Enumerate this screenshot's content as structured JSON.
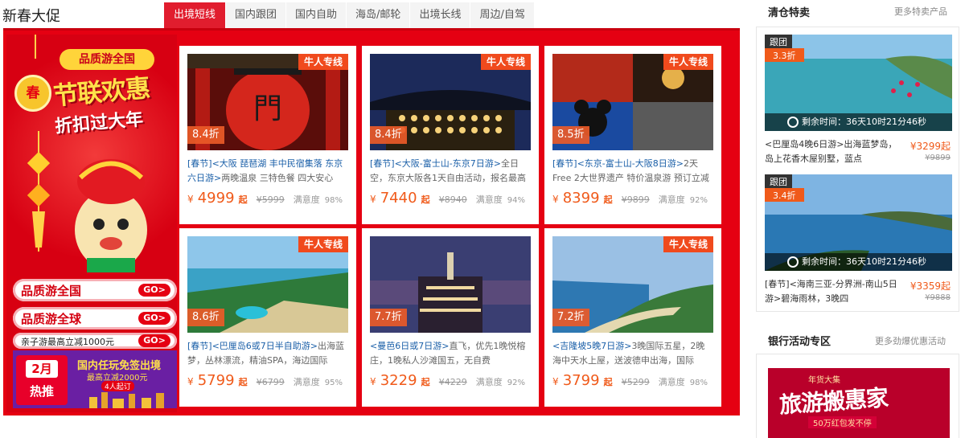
{
  "header": {
    "title": "新春大促"
  },
  "tabs": [
    {
      "label": "出境短线",
      "active": true
    },
    {
      "label": "国内跟团",
      "active": false
    },
    {
      "label": "国内自助",
      "active": false
    },
    {
      "label": "海岛/邮轮",
      "active": false
    },
    {
      "label": "出境长线",
      "active": false
    },
    {
      "label": "周边/自驾",
      "active": false
    }
  ],
  "banner": {
    "chun": "春",
    "subtitle": "品质游全国",
    "title": "节联欢惠",
    "tagline": "折扣过大年",
    "links": [
      {
        "label": "品质游全国",
        "go": "GO>"
      },
      {
        "label": "品质游全球",
        "go": "GO>"
      },
      {
        "label": "亲子游最高立减1000元",
        "go": "GO>"
      }
    ],
    "promo": {
      "month": "2月",
      "hot": "热推",
      "line1": "国内任玩免签出境",
      "line2": "最高立减2000元",
      "line3": "4人起订"
    }
  },
  "products": [
    {
      "ribbon": "牛人专线",
      "discount": "8.4折",
      "tag": "[春节]",
      "highlight": "<大阪 琵琶湖 丰中民宿集落 东京六日游>",
      "rest": "两晚温泉 三特色餐 四大安心",
      "yen": "¥",
      "price": "4999",
      "qi": "起",
      "old": "¥5999",
      "sat_label": "满意度",
      "sat": "98%"
    },
    {
      "ribbon": "牛人专线",
      "discount": "8.4折",
      "tag": "[春节]",
      "highlight": "<大阪-富士山-东京7日游>",
      "rest": "全日空，东京大阪各1天自由活动，报名最高立减",
      "yen": "¥",
      "price": "7440",
      "qi": "起",
      "old": "¥8940",
      "sat_label": "满意度",
      "sat": "94%"
    },
    {
      "ribbon": "牛人专线",
      "discount": "8.5折",
      "tag": "[春节]",
      "highlight": "<东京-富士山-大阪8日游>",
      "rest": "2天Free 2大世界遗产 特价温泉游 预订立减",
      "yen": "¥",
      "price": "8399",
      "qi": "起",
      "old": "¥9899",
      "sat_label": "满意度",
      "sat": "92%"
    },
    {
      "ribbon": "牛人专线",
      "discount": "8.6折",
      "tag": "[春节]",
      "highlight": "<巴厘岛6或7日半自助游>",
      "rest": "出海蓝梦，丛林漂流，精油SPA，海边国际",
      "yen": "¥",
      "price": "5799",
      "qi": "起",
      "old": "¥6799",
      "sat_label": "满意度",
      "sat": "95%"
    },
    {
      "ribbon": "",
      "discount": "7.7折",
      "tag": "",
      "highlight": "<曼芭6日或7日游>",
      "rest": "直飞，优先1晚悦榕庄，1晚私人沙滩国五，无自费",
      "yen": "¥",
      "price": "3229",
      "qi": "起",
      "old": "¥4229",
      "sat_label": "满意度",
      "sat": "92%"
    },
    {
      "ribbon": "牛人专线",
      "discount": "7.2折",
      "tag": "",
      "highlight": "<吉隆坡5晚7日游>",
      "rest": "3晚国际五星，2晚海中天水上屋，送波德申出海，国际",
      "yen": "¥",
      "price": "3799",
      "qi": "起",
      "old": "¥5299",
      "sat_label": "满意度",
      "sat": "98%"
    }
  ],
  "clearance": {
    "title": "清仓特卖",
    "more": "更多特卖产品",
    "deals": [
      {
        "type": "跟团",
        "discount": "3.3折",
        "timer_label": "剩余时间：",
        "timer": "36天10时21分46秒",
        "text": "<巴厘岛4晚6日游>出海蓝梦岛，岛上花香木屋别墅，蓝点",
        "price": "¥3299起",
        "old": "¥9899"
      },
      {
        "type": "跟团",
        "discount": "3.4折",
        "timer_label": "剩余时间：",
        "timer": "36天10时21分46秒",
        "text": "[春节]<海南三亚-分界洲-南山5日游>碧海雨林，3晚四",
        "price": "¥3359起",
        "old": "¥9888"
      }
    ]
  },
  "bank": {
    "title": "银行活动专区",
    "more": "更多劲爆优惠活动",
    "banner_top": "年货大集",
    "banner_main": "旅游搬惠家",
    "banner_sub": "50万红包发不停"
  },
  "colors": {
    "accent": "#e50012",
    "price": "#f05a1a",
    "tab_active": "#e11d2e"
  }
}
